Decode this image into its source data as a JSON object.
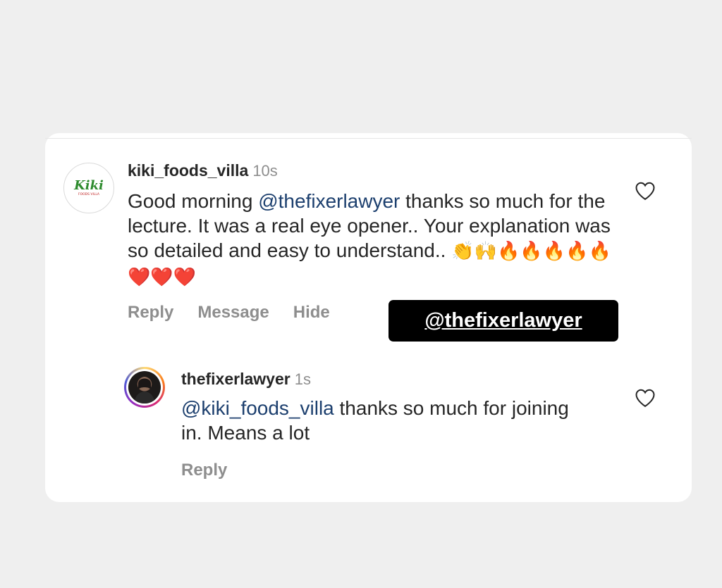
{
  "comment": {
    "username": "kiki_foods_villa",
    "time": "10s",
    "avatar_text": "Kiki",
    "avatar_subtext": "FOODS VILLA",
    "text_before": "Good morning ",
    "mention": "@thefixerlawyer",
    "text_after": " thanks so much for the lecture. It was a real eye opener.. Your explanation was so detailed and easy to understand.. ",
    "emojis": "👏🙌🔥🔥🔥🔥🔥❤️❤️❤️",
    "actions": {
      "reply": "Reply",
      "message": "Message",
      "hide": "Hide"
    }
  },
  "tag_sticker": "@thefixerlawyer",
  "reply": {
    "username": "thefixerlawyer",
    "time": "1s",
    "mention": "@kiki_foods_villa",
    "text_after": " thanks so much for joining in. Means a lot",
    "actions": {
      "reply": "Reply"
    }
  },
  "colors": {
    "background": "#efefef",
    "card": "#ffffff",
    "mention": "#1c3f6e",
    "secondary_text": "#8e8e8e",
    "sticker": "#000000"
  }
}
